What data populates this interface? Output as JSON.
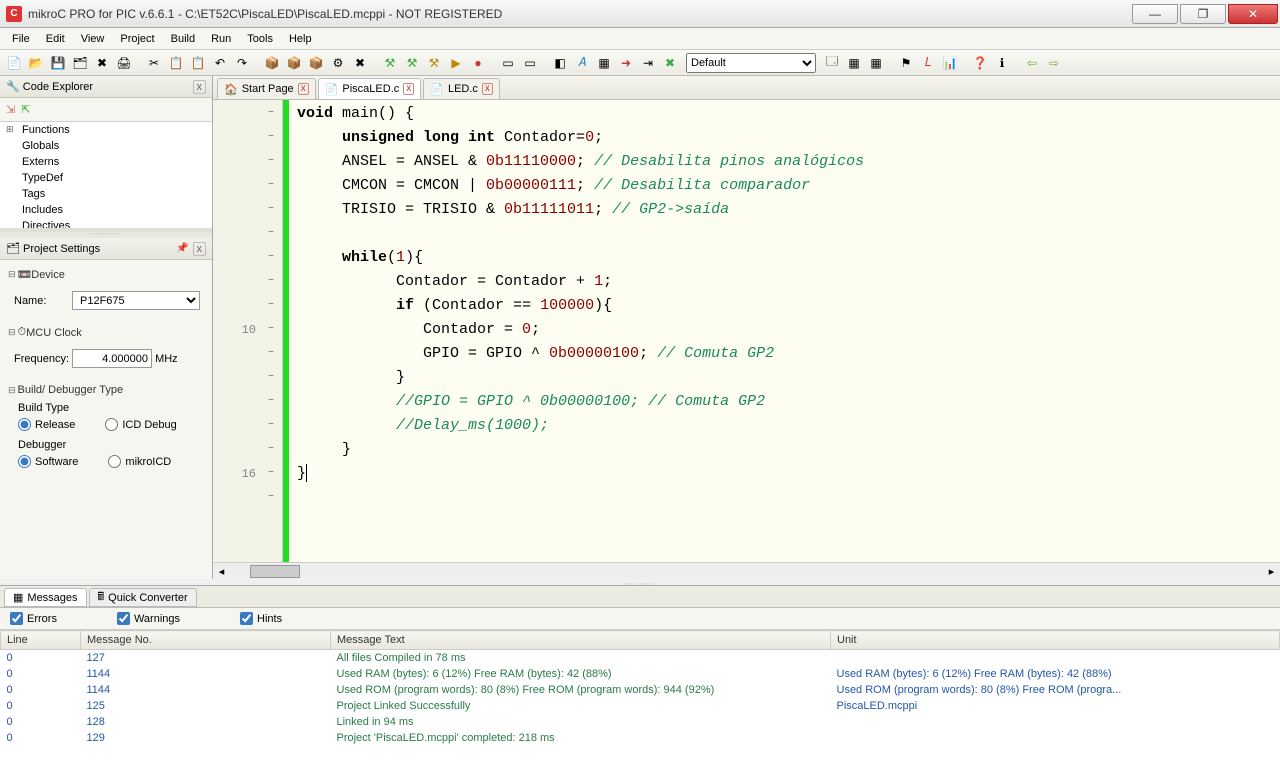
{
  "window": {
    "title": "mikroC PRO for PIC v.6.6.1 - C:\\ET52C\\PiscaLED\\PiscaLED.mcppi - NOT REGISTERED"
  },
  "menu": [
    "File",
    "Edit",
    "View",
    "Project",
    "Build",
    "Run",
    "Tools",
    "Help"
  ],
  "toolbar_combo": "Default",
  "code_explorer": {
    "title": "Code Explorer",
    "items": [
      "Functions",
      "Globals",
      "Externs",
      "TypeDef",
      "Tags",
      "Includes",
      "Directives"
    ]
  },
  "project_settings": {
    "title": "Project Settings",
    "device_section": "Device",
    "name_label": "Name:",
    "device": "P12F675",
    "mcu_section": "MCU Clock",
    "freq_label": "Frequency:",
    "freq_value": "4.000000",
    "freq_unit": "MHz",
    "build_section": "Build/ Debugger Type",
    "build_type_label": "Build Type",
    "release": "Release",
    "icd": "ICD Debug",
    "debugger_label": "Debugger",
    "software": "Software",
    "mikroicd": "mikroICD"
  },
  "tabs": [
    {
      "label": "Start Page",
      "active": false
    },
    {
      "label": "PiscaLED.c",
      "active": true
    },
    {
      "label": "LED.c",
      "active": false
    }
  ],
  "gutter_lines": [
    "",
    "",
    "",
    "",
    "",
    "",
    "",
    "",
    "",
    "10",
    "",
    "",
    "",
    "",
    "",
    "16",
    ""
  ],
  "messages": {
    "tab1": "Messages",
    "tab2": "Quick Converter",
    "errors": "Errors",
    "warnings": "Warnings",
    "hints": "Hints",
    "cols": [
      "Line",
      "Message No.",
      "Message Text",
      "Unit"
    ],
    "rows": [
      {
        "l": "0",
        "n": "127",
        "t": "All files Compiled in 78 ms",
        "u": ""
      },
      {
        "l": "0",
        "n": "1144",
        "t": "Used RAM (bytes): 6 (12%)  Free RAM (bytes): 42 (88%)",
        "u": "Used RAM (bytes): 6 (12%)  Free RAM (bytes): 42 (88%)"
      },
      {
        "l": "0",
        "n": "1144",
        "t": "Used ROM (program words): 80 (8%)  Free ROM (program words): 944 (92%)",
        "u": "Used ROM (program words): 80 (8%)  Free ROM (progra..."
      },
      {
        "l": "0",
        "n": "125",
        "t": "Project Linked Successfully",
        "u": "PiscaLED.mcppi"
      },
      {
        "l": "0",
        "n": "128",
        "t": "Linked in 94 ms",
        "u": ""
      },
      {
        "l": "0",
        "n": "129",
        "t": "Project 'PiscaLED.mcppi' completed: 218 ms",
        "u": ""
      }
    ]
  }
}
